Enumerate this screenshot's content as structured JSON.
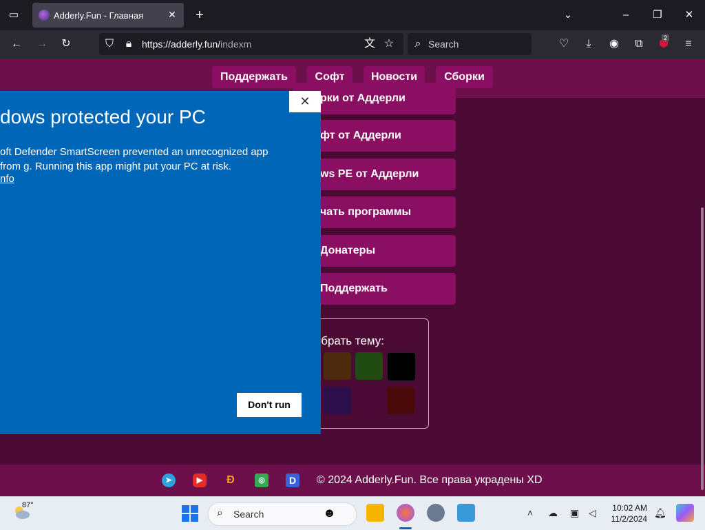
{
  "browser": {
    "tab_title": "Adderly.Fun - Главная",
    "url_host": "https://adderly.fun/",
    "url_path": "indexm",
    "search_placeholder": "Search",
    "extension_badge": "2"
  },
  "site": {
    "nav": [
      "Поддержать",
      "Софт",
      "Новости",
      "Сборки"
    ],
    "menu": [
      "рки от Аддерли",
      "фт от Аддерли",
      "ws PE от Аддерли",
      "чать программы",
      "Донатеры",
      "Поддержать"
    ],
    "theme_label": "ыбрать тему:",
    "theme_colors": [
      "#4d2a0e",
      "#1f4a12",
      "#000000",
      "#2a0f4a",
      "#4d0a38",
      "#4a0a0a"
    ],
    "footer_text": "© 2024 Adderly.Fun. Все права украдены XD",
    "social_icons": [
      "telegram-icon",
      "youtube-icon",
      "donationalerts-icon",
      "tripadvisor-icon",
      "d-icon"
    ]
  },
  "smartscreen": {
    "title": "dows protected your PC",
    "description": "oft Defender SmartScreen prevented an unrecognized app from g. Running this app might put your PC at risk.",
    "more_info": "nfo",
    "dont_run": "Don't run"
  },
  "taskbar": {
    "weather_temp": "87°",
    "search_placeholder": "Search",
    "time": "10:02 AM",
    "date": "11/2/2024"
  }
}
